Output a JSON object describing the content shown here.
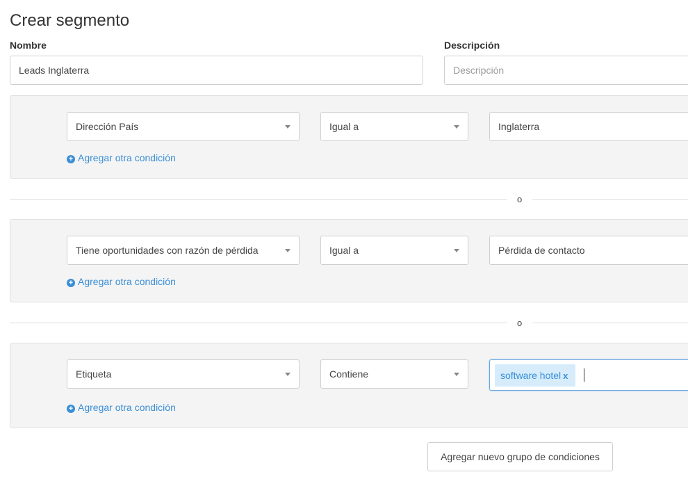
{
  "page": {
    "title": "Crear segmento"
  },
  "form": {
    "name_label": "Nombre",
    "name_value": "Leads Inglaterra",
    "description_label": "Descripción",
    "description_placeholder": "Descripción"
  },
  "groups": [
    {
      "field": "Dirección País",
      "operator": "Igual a",
      "value": "Inglaterra",
      "add_condition": "Agregar otra condición"
    },
    {
      "field": "Tiene oportunidades con razón de pérdida",
      "operator": "Igual a",
      "value": "Pérdida de contacto",
      "add_condition": "Agregar otra condición"
    },
    {
      "field": "Etiqueta",
      "operator": "Contiene",
      "tags": [
        "software hotel"
      ],
      "tag_remove": "x",
      "add_condition": "Agregar otra condición"
    }
  ],
  "dividers": [
    "o",
    "o"
  ],
  "actions": {
    "add_group_label": "Agregar nuevo grupo de condiciones"
  },
  "colors": {
    "accent": "#3a8fd6",
    "group_bg": "#f4f4f4",
    "tag_bg": "#d6ecfb"
  }
}
